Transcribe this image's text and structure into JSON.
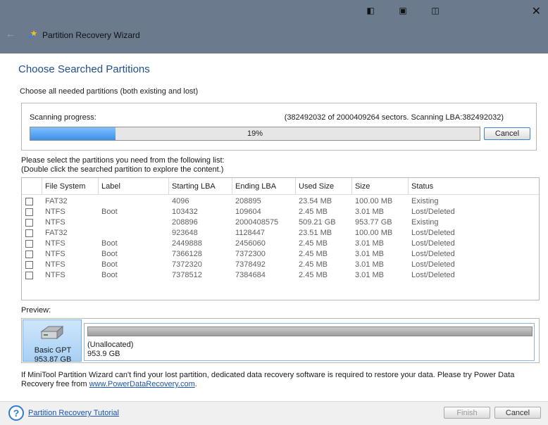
{
  "window": {
    "title": "Partition Recovery Wizard",
    "controls": [
      "◧",
      "▣",
      "◫"
    ],
    "close": "✕",
    "back": "←"
  },
  "page": {
    "heading": "Choose Searched Partitions",
    "subtitle": "Choose all needed partitions (both existing and lost)"
  },
  "scan": {
    "label": "Scanning progress:",
    "status": "(382492032 of 2000409264 sectors. Scanning LBA:382492032)",
    "progress_text": "19%",
    "progress_value": 0.19,
    "cancel_label": "Cancel"
  },
  "instructions": {
    "line1": "Please select the partitions you need from the following list:",
    "line2": "(Double click the searched partition to explore the content.)"
  },
  "table": {
    "columns": [
      "File System",
      "Label",
      "Starting LBA",
      "Ending LBA",
      "Used Size",
      "Size",
      "Status"
    ],
    "rows": [
      [
        "FAT32",
        "",
        "4096",
        "208895",
        "23.54 MB",
        "100.00 MB",
        "Existing"
      ],
      [
        "NTFS",
        "Boot",
        "103432",
        "109604",
        "2.45 MB",
        "3.01 MB",
        "Lost/Deleted"
      ],
      [
        "NTFS",
        "",
        "208896",
        "2000408575",
        "509.21 GB",
        "953.77 GB",
        "Existing"
      ],
      [
        "FAT32",
        "",
        "923648",
        "1128447",
        "23.51 MB",
        "100.00 MB",
        "Lost/Deleted"
      ],
      [
        "NTFS",
        "Boot",
        "2449888",
        "2456060",
        "2.45 MB",
        "3.01 MB",
        "Lost/Deleted"
      ],
      [
        "NTFS",
        "Boot",
        "7366128",
        "7372300",
        "2.45 MB",
        "3.01 MB",
        "Lost/Deleted"
      ],
      [
        "NTFS",
        "Boot",
        "7372320",
        "7378492",
        "2.45 MB",
        "3.01 MB",
        "Lost/Deleted"
      ],
      [
        "NTFS",
        "Boot",
        "7378512",
        "7384684",
        "2.45 MB",
        "3.01 MB",
        "Lost/Deleted"
      ]
    ]
  },
  "preview": {
    "label": "Preview:",
    "disk_name": "Basic GPT",
    "disk_size": "953.87 GB",
    "partition_name": "(Unallocated)",
    "partition_size": "953.9 GB"
  },
  "notice": {
    "line1": "If MiniTool Partition Wizard can't find your lost partition, dedicated data recovery software is required to restore your data. Please try Power Data",
    "line2_prefix": "Recovery free from ",
    "link": "www.PowerDataRecovery.com",
    "line2_suffix": "."
  },
  "footer": {
    "help_icon": "?",
    "tutorial_link": "Partition Recovery Tutorial",
    "finish_label": "Finish",
    "cancel_label": "Cancel"
  },
  "colors": {
    "titlebar": "#6b7b8d",
    "heading": "#1e4f8f",
    "progress": "#3d90e6",
    "link": "#1a55b0"
  }
}
